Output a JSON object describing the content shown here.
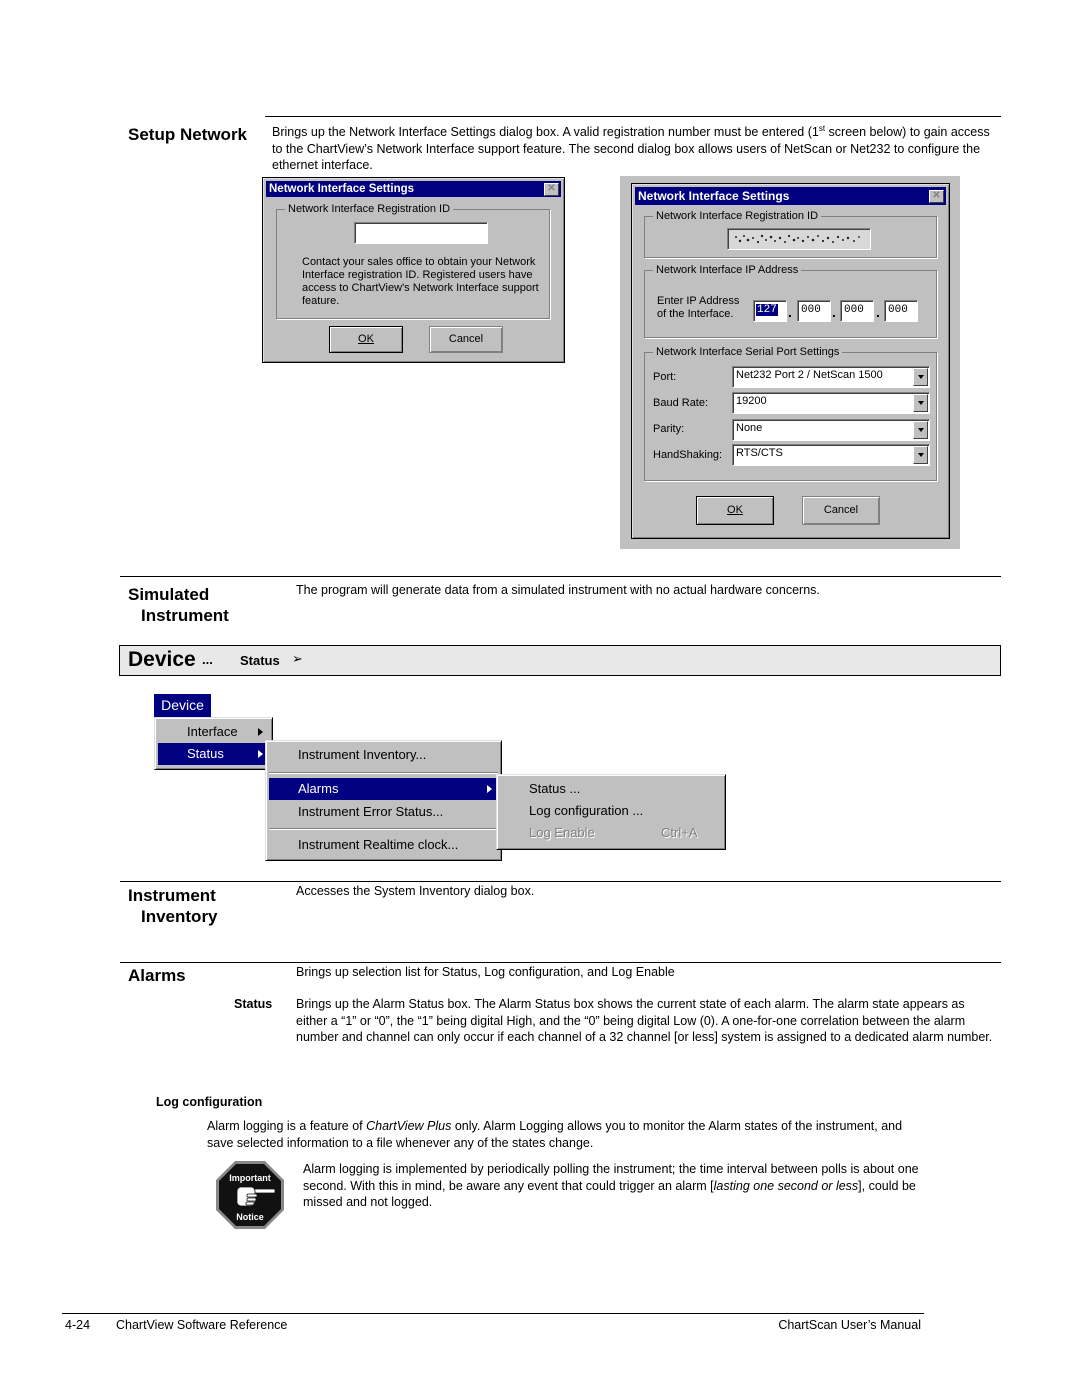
{
  "setup_network": {
    "title": "Setup Network",
    "text_before_sup": "Brings up the Network Interface Settings dialog box.  A valid registration number must be entered (1",
    "sup": "st",
    "text_after_sup": " screen below) to gain access to the ChartView’s Network Interface support feature.  The second dialog box allows users of NetScan or Net232 to configure the ethernet interface."
  },
  "dialog1": {
    "title": "Network Interface Settings",
    "group_label": "Network Interface Registration ID",
    "registration_id_value": "",
    "message": "Contact your sales office to obtain your Network Interface registration ID.  Registered users have access to ChartView's Network Interface support feature.",
    "ok_label": "OK",
    "cancel_label": "Cancel"
  },
  "dialog2": {
    "title": "Network Interface Settings",
    "reg_group_label": "Network Interface Registration ID",
    "ip_group_label": "Network Interface IP Address",
    "ip_label_line1": "Enter IP Address",
    "ip_label_line2": "of the Interface.",
    "ip_octets": [
      "127",
      "000",
      "000",
      "000"
    ],
    "ip_dot": ".",
    "serial_group_label": "Network Interface Serial Port Settings",
    "fields": [
      {
        "label": "Port:",
        "value": "Net232 Port 2 / NetScan 1500"
      },
      {
        "label": "Baud Rate:",
        "value": "19200"
      },
      {
        "label": "Parity:",
        "value": "None"
      },
      {
        "label": "HandShaking:",
        "value": "RTS/CTS"
      }
    ],
    "ok_label": "OK",
    "cancel_label": "Cancel"
  },
  "simulated": {
    "title_line1": "Simulated",
    "title_line2": "Instrument",
    "text": "The program will generate data from a simulated instrument with no actual hardware concerns."
  },
  "device_bar": {
    "title": "Device",
    "ellipsis": "...",
    "sub": "Status",
    "chevron": "➢"
  },
  "menu": {
    "top_label": "Device",
    "level1": [
      {
        "label": "Interface",
        "selected": false
      },
      {
        "label": "Status",
        "selected": true
      }
    ],
    "level2": [
      {
        "label": "Instrument Inventory..."
      },
      {
        "label": "Alarms"
      },
      {
        "label": "Instrument Error Status..."
      },
      {
        "label": "Instrument Realtime clock..."
      }
    ],
    "level3": [
      {
        "label": "Status ...",
        "shortcut": ""
      },
      {
        "label": "Log configuration ...",
        "shortcut": ""
      },
      {
        "label": "Log Enable",
        "shortcut": "Ctrl+A"
      }
    ]
  },
  "instrument_inventory": {
    "title_line1": "Instrument",
    "title_line2": "Inventory",
    "text": "Accesses the System Inventory dialog box."
  },
  "alarms": {
    "title": "Alarms",
    "text": "Brings up selection list for Status, Log configuration, and Log Enable",
    "status_label": "Status",
    "status_text": "Brings up the Alarm Status box. The Alarm Status box shows the current state of each alarm.  The alarm state appears as either a “1” or “0”, the “1” being digital High, and the “0” being digital Low (0).  A one-for-one correlation between the alarm number and channel can only occur if each channel of a 32 channel [or less] system is assigned to a dedicated alarm number.",
    "log_config_label": "Log configuration",
    "log_para_pre": "Alarm logging is a feature of ",
    "log_para_em": "ChartView Plus",
    "log_para_post": " only.   Alarm Logging allows you to monitor the Alarm states of the instrument, and save selected information to a file whenever any of the states change.",
    "notice_top": "Important",
    "notice_bottom": "Notice",
    "notice_pre": "Alarm logging is implemented by periodically polling the instrument; the time interval between polls is about one second.   With this in mind, be aware any event that could trigger an alarm [",
    "notice_em": "lasting one second or less",
    "notice_post": "], could be missed and not logged."
  },
  "footer": {
    "page": "4-24",
    "left": "ChartView Software Reference",
    "right": "ChartScan User’s Manual"
  }
}
